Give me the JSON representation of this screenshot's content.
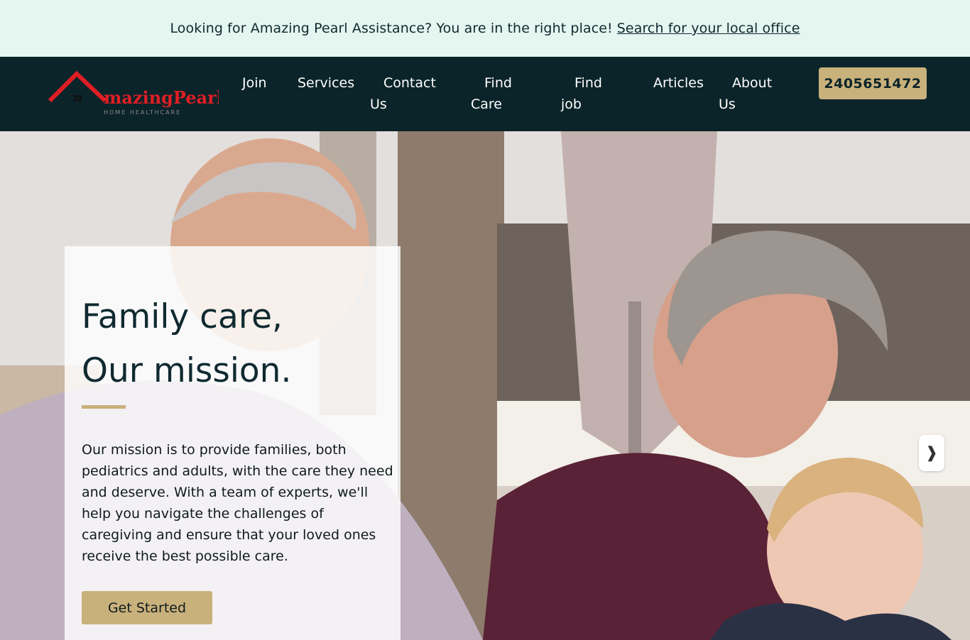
{
  "announcement": {
    "message": "Looking for Amazing Pearl Assistance? You are in the right place!",
    "link_text": "Search for your local office"
  },
  "brand": {
    "logo_letter": "A",
    "logo_name": "mazingPearl",
    "logo_tagline": "HOME HEALTHCARE",
    "logo_icon": "house-roof-icon"
  },
  "nav": {
    "items": [
      {
        "line1": "Join",
        "line2": ""
      },
      {
        "line1": "Services",
        "line2": ""
      },
      {
        "line1": "Contact",
        "line2": "Us"
      },
      {
        "line1": "Find",
        "line2": "Care"
      },
      {
        "line1": "Find",
        "line2": "job"
      },
      {
        "line1": "Articles",
        "line2": ""
      },
      {
        "line1": "About",
        "line2": "Us"
      }
    ],
    "phone": "2405651472"
  },
  "hero": {
    "title_line1": "Family care,",
    "title_line2": "Our mission.",
    "body": "Our mission is to provide families, both pediatrics and adults, with the care they need and deserve. With a team of experts, we'll help you navigate the challenges of caregiving and ensure that your loved ones receive the best possible care.",
    "cta_label": "Get Started",
    "next_icon": "chevron-right-icon",
    "next_glyph": "❱"
  },
  "colors": {
    "announcement_bg": "#e5f5ef",
    "nav_bg": "#0b2429",
    "accent": "#c9b17c",
    "logo_red": "#e01e25"
  }
}
